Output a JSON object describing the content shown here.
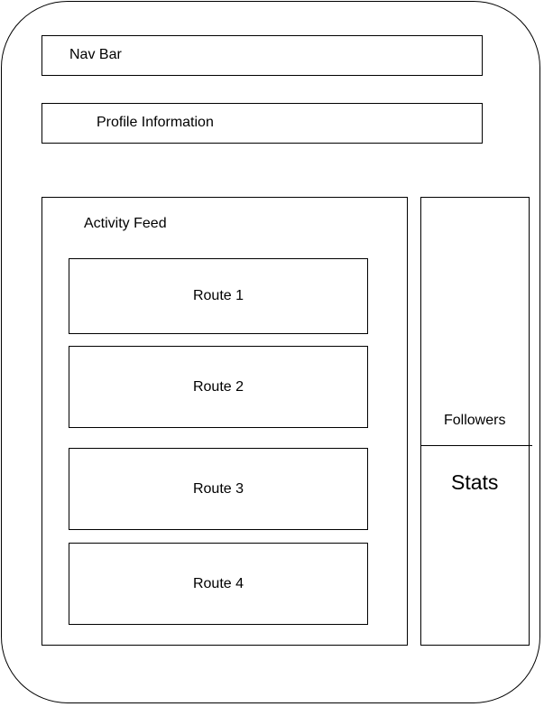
{
  "nav_bar": {
    "label": "Nav Bar"
  },
  "profile": {
    "label": "Profile Information"
  },
  "activity_feed": {
    "label": "Activity Feed",
    "routes": [
      "Route 1",
      "Route 2",
      "Route 3",
      "Route 4"
    ]
  },
  "sidebar": {
    "followers_label": "Followers",
    "stats_label": "Stats"
  }
}
